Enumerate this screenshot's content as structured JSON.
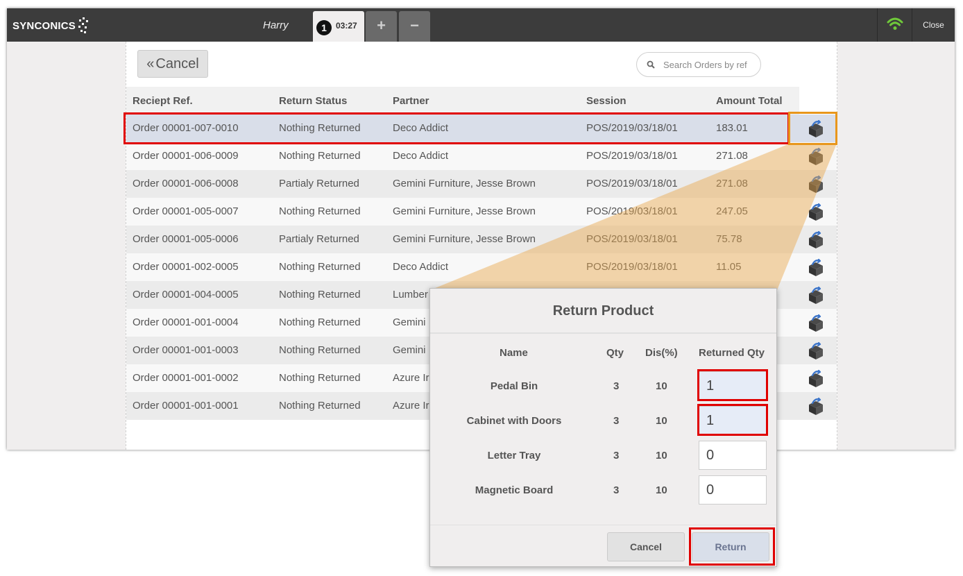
{
  "topbar": {
    "logo_text": "SYNCONICS",
    "cashier": "Harry",
    "order_number": "1",
    "order_time": "03:27",
    "add_label": "+",
    "remove_label": "−",
    "close_label": "Close"
  },
  "screen": {
    "cancel_label": "Cancel",
    "search_placeholder": "Search Orders by ref"
  },
  "table": {
    "headers": [
      "Reciept Ref.",
      "Return Status",
      "Partner",
      "Session",
      "Amount Total"
    ],
    "rows": [
      {
        "ref": "Order 00001-007-0010",
        "status": "Nothing Returned",
        "partner": "Deco Addict",
        "session": "POS/2019/03/18/01",
        "amount": "183.01"
      },
      {
        "ref": "Order 00001-006-0009",
        "status": "Nothing Returned",
        "partner": "Deco Addict",
        "session": "POS/2019/03/18/01",
        "amount": "271.08"
      },
      {
        "ref": "Order 00001-006-0008",
        "status": "Partialy Returned",
        "partner": "Gemini Furniture, Jesse Brown",
        "session": "POS/2019/03/18/01",
        "amount": "271.08"
      },
      {
        "ref": "Order 00001-005-0007",
        "status": "Nothing Returned",
        "partner": "Gemini Furniture, Jesse Brown",
        "session": "POS/2019/03/18/01",
        "amount": "247.05"
      },
      {
        "ref": "Order 00001-005-0006",
        "status": "Partialy Returned",
        "partner": "Gemini Furniture, Jesse Brown",
        "session": "POS/2019/03/18/01",
        "amount": "75.78"
      },
      {
        "ref": "Order 00001-002-0005",
        "status": "Nothing Returned",
        "partner": "Deco Addict",
        "session": "POS/2019/03/18/01",
        "amount": "11.05"
      },
      {
        "ref": "Order 00001-004-0005",
        "status": "Nothing Returned",
        "partner": "Lumber",
        "session": "",
        "amount": ""
      },
      {
        "ref": "Order 00001-001-0004",
        "status": "Nothing Returned",
        "partner": "Gemini",
        "session": "",
        "amount": ""
      },
      {
        "ref": "Order 00001-001-0003",
        "status": "Nothing Returned",
        "partner": "Gemini",
        "session": "",
        "amount": ""
      },
      {
        "ref": "Order 00001-001-0002",
        "status": "Nothing Returned",
        "partner": "Azure Ir",
        "session": "",
        "amount": ""
      },
      {
        "ref": "Order 00001-001-0001",
        "status": "Nothing Returned",
        "partner": "Azure Ir",
        "session": "",
        "amount": ""
      }
    ]
  },
  "modal": {
    "title": "Return Product",
    "headers": [
      "Name",
      "Qty",
      "Dis(%)",
      "Returned Qty"
    ],
    "lines": [
      {
        "name": "Pedal Bin",
        "qty": "3",
        "discount": "10",
        "returned": "1"
      },
      {
        "name": "Cabinet with Doors",
        "qty": "3",
        "discount": "10",
        "returned": "1"
      },
      {
        "name": "Letter Tray",
        "qty": "3",
        "discount": "10",
        "returned": "0"
      },
      {
        "name": "Magnetic Board",
        "qty": "3",
        "discount": "10",
        "returned": "0"
      }
    ],
    "cancel_label": "Cancel",
    "return_label": "Return"
  },
  "colors": {
    "topbar": "#3c3c3c",
    "highlight_red": "#e00000",
    "highlight_orange": "#e8961c",
    "selected_row": "#d9dee9",
    "wifi": "#6fc93a"
  }
}
